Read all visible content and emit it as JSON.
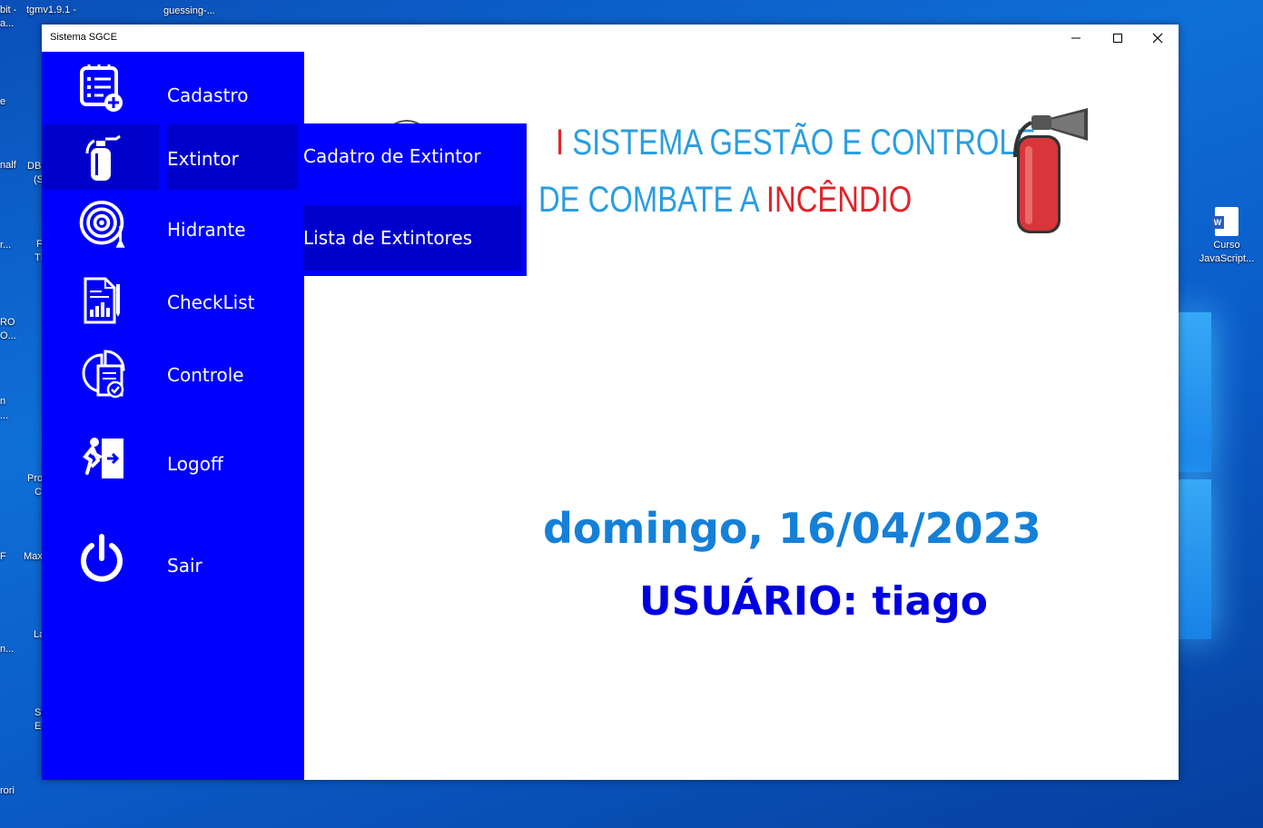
{
  "desktop": {
    "top_labels": [
      "bit -",
      "tgmv1.9.1 -",
      "guessing-..."
    ],
    "left_labels": [
      "a...",
      "e",
      "nalf",
      "DB",
      "(S",
      "r...",
      "F",
      "TI",
      "RO",
      "O...",
      "n",
      "...",
      "Pro",
      "C",
      "F",
      "Max",
      "La",
      "n...",
      "Si",
      "E",
      "rori"
    ],
    "shortcut": {
      "icon": "word-document-icon",
      "label_line1": "Curso",
      "label_line2": "JavaScript..."
    }
  },
  "window": {
    "title": "Sistema SGCE",
    "controls": {
      "minimize": "minimize-icon",
      "maximize": "maximize-icon",
      "close": "close-icon"
    }
  },
  "sidebar": {
    "items": [
      {
        "label": "Cadastro",
        "icon": "register-list-icon"
      },
      {
        "label": "Extintor",
        "icon": "fire-extinguisher-icon"
      },
      {
        "label": "Hidrante",
        "icon": "hydrant-hose-icon"
      },
      {
        "label": "CheckList",
        "icon": "report-document-icon"
      },
      {
        "label": "Controle",
        "icon": "chart-control-icon"
      },
      {
        "label": "Logoff",
        "icon": "exit-door-icon"
      },
      {
        "label": "Sair",
        "icon": "power-icon"
      }
    ]
  },
  "submenu": {
    "items": [
      {
        "label": "Cadatro de Extintor"
      },
      {
        "label": "Lista de Extintores"
      }
    ]
  },
  "banner": {
    "line1": "SISTEMA GESTÃO E CONTROLE",
    "line2_prefix": "DE COMBATE A ",
    "line2_highlight": "INCÊNDIO"
  },
  "main": {
    "date": "domingo, 16/04/2023",
    "user": "USUÁRIO: tiago"
  },
  "colors": {
    "sidebar": "#0000ff",
    "active": "#0000cc",
    "banner_blue": "#2a9ee0",
    "banner_red": "#e0242a",
    "date_color": "#1580d8",
    "user_color": "#0000e0"
  }
}
